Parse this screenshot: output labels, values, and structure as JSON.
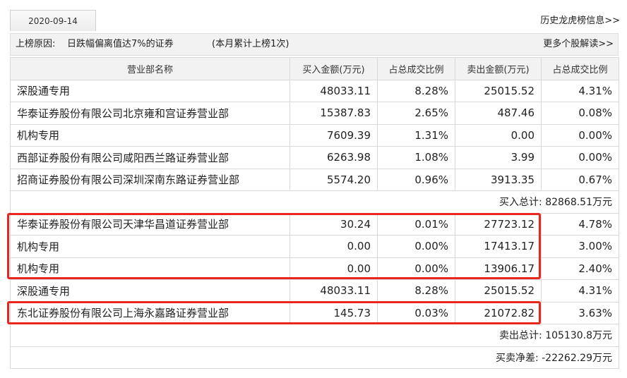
{
  "date_tab": "2020-09-14",
  "history_link": "历史龙虎榜信息>>",
  "info_bar": {
    "reason_label": "上榜原因:",
    "reason_text": "日跌幅偏离值达7%的证券",
    "monthly_count": "(本月累计上榜1次)",
    "more_link": "更多个股解读>>"
  },
  "columns": [
    "营业部名称",
    "买入金额(万元)",
    "占总成交比例",
    "卖出金额(万元)",
    "占总成交比例"
  ],
  "buy_rows": [
    {
      "name": "深股通专用",
      "buy": "48033.11",
      "buy_pct": "8.28%",
      "sell": "25015.52",
      "sell_pct": "4.31%"
    },
    {
      "name": "华泰证券股份有限公司北京雍和宫证券营业部",
      "buy": "15387.83",
      "buy_pct": "2.65%",
      "sell": "487.46",
      "sell_pct": "0.08%"
    },
    {
      "name": "机构专用",
      "buy": "7609.39",
      "buy_pct": "1.31%",
      "sell": "0.00",
      "sell_pct": "0.00%"
    },
    {
      "name": "西部证券股份有限公司咸阳西兰路证券营业部",
      "buy": "6263.98",
      "buy_pct": "1.08%",
      "sell": "3.99",
      "sell_pct": "0.00%"
    },
    {
      "name": "招商证券股份有限公司深圳深南东路证券营业部",
      "buy": "5574.20",
      "buy_pct": "0.96%",
      "sell": "3913.35",
      "sell_pct": "0.67%"
    }
  ],
  "buy_total": "买入总计: 82868.51万元",
  "sell_rows": [
    {
      "name": "华泰证券股份有限公司天津华昌道证券营业部",
      "buy": "30.24",
      "buy_pct": "0.01%",
      "sell": "27723.12",
      "sell_pct": "4.78%"
    },
    {
      "name": "机构专用",
      "buy": "0.00",
      "buy_pct": "0.00%",
      "sell": "17413.17",
      "sell_pct": "3.00%"
    },
    {
      "name": "机构专用",
      "buy": "0.00",
      "buy_pct": "0.00%",
      "sell": "13906.17",
      "sell_pct": "2.40%"
    },
    {
      "name": "深股通专用",
      "buy": "48033.11",
      "buy_pct": "8.28%",
      "sell": "25015.52",
      "sell_pct": "4.31%"
    },
    {
      "name": "东北证券股份有限公司上海永嘉路证券营业部",
      "buy": "145.73",
      "buy_pct": "0.03%",
      "sell": "21072.82",
      "sell_pct": "3.63%"
    }
  ],
  "sell_total": "卖出总计: 105130.8万元",
  "net_total": "买卖净差: -22262.29万元",
  "colors": {
    "highlight": "#e8261d",
    "header_bg": "#f2f2f2",
    "border": "#d9d9d9"
  }
}
